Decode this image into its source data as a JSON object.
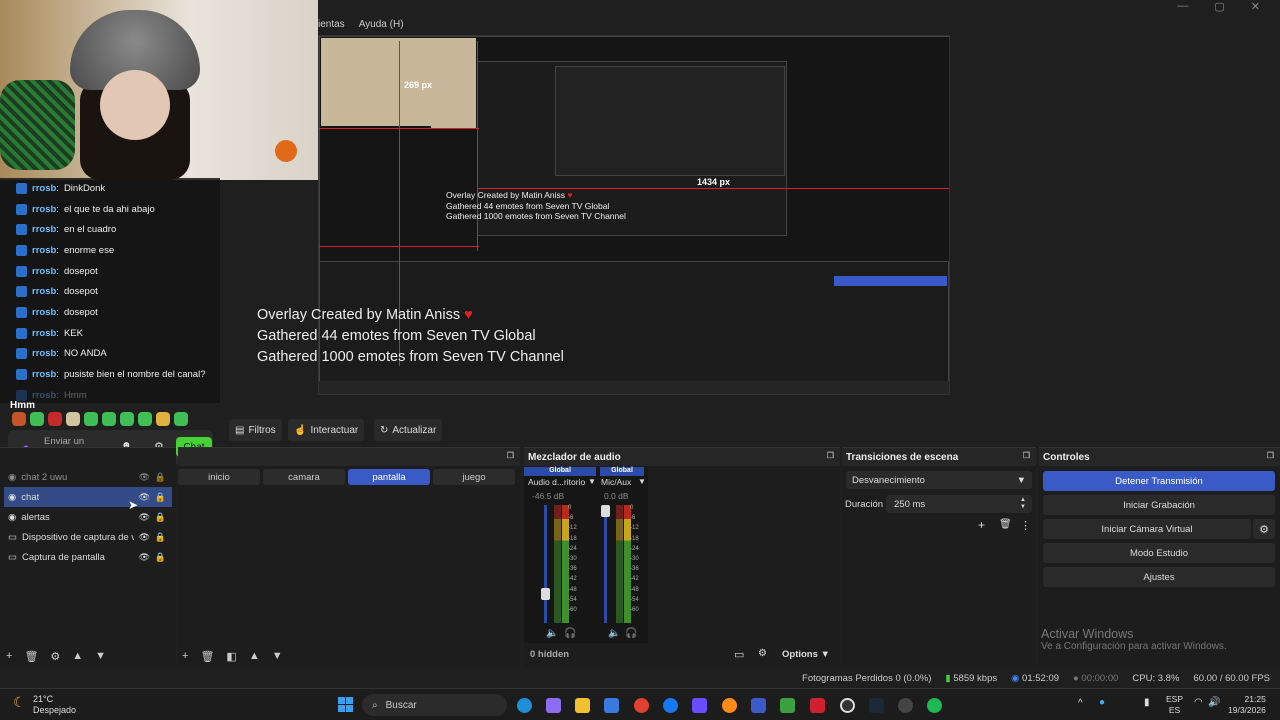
{
  "menu": {
    "items": [
      "ientas",
      "Ayuda (H)"
    ]
  },
  "window_controls": [
    "—",
    "▢",
    "✕"
  ],
  "chat": {
    "messages": [
      {
        "user": "rrosb",
        "text": "DinkDonk"
      },
      {
        "user": "rrosb",
        "text": "el que te da ahi abajo"
      },
      {
        "user": "rrosb",
        "text": "en el cuadro"
      },
      {
        "user": "rrosb",
        "text": "enorme ese"
      },
      {
        "user": "rrosb",
        "text": "dosepot"
      },
      {
        "user": "rrosb",
        "text": "dosepot"
      },
      {
        "user": "rrosb",
        "text": "dosepot"
      },
      {
        "user": "rrosb",
        "text": "KEK"
      },
      {
        "user": "rrosb",
        "text": "NO ANDA"
      },
      {
        "user": "rrosb",
        "text": "pusiste bien el nombre del canal?"
      },
      {
        "user": "rrosb",
        "text": "Hmm"
      }
    ],
    "highlight": "Hmm",
    "input_placeholder": "Enviar un mensaje",
    "chat_button": "Chat"
  },
  "overlay": {
    "line1": "Overlay Created by Matin Aniss",
    "line2": "Gathered 44 emotes from Seven TV Global",
    "line3": "Gathered 1000 emotes from Seven TV Channel",
    "measure_269": "269 px",
    "measure_1434": "1434 px"
  },
  "toolbar": {
    "filters": "Filtros",
    "interact": "Interactuar",
    "refresh": "Actualizar"
  },
  "sources": {
    "items": [
      {
        "name": "chat 2 uwu",
        "selected": false
      },
      {
        "name": "chat",
        "selected": true
      },
      {
        "name": "alertas",
        "selected": false
      },
      {
        "name": "Dispositivo de captura de vid",
        "selected": false
      },
      {
        "name": "Captura de pantalla",
        "selected": false
      }
    ]
  },
  "scenes": {
    "items": [
      {
        "name": "inicio",
        "selected": false
      },
      {
        "name": "camara",
        "selected": false
      },
      {
        "name": "pantalla",
        "selected": true
      },
      {
        "name": "juego",
        "selected": false
      }
    ]
  },
  "mixer": {
    "title": "Mezclador de audio",
    "channels": [
      {
        "header": "Global",
        "name": "Audio d...ritorio",
        "db": "-46.5 dB",
        "level": 0.22
      },
      {
        "header": "Global",
        "name": "Mic/Aux",
        "db": "0.0 dB",
        "level": 1.0
      }
    ],
    "scale": [
      "0",
      "-6",
      "-12",
      "-18",
      "-24",
      "-30",
      "-36",
      "-42",
      "-48",
      "-54",
      "-60"
    ],
    "hidden": "0 hidden",
    "options": "Options"
  },
  "transitions": {
    "title": "Transiciones de escena",
    "selected": "Desvanecimiento",
    "duration_label": "Duración",
    "duration_value": "250 ms"
  },
  "controls": {
    "title": "Controles",
    "buttons": [
      "Detener Transmisión",
      "Iniciar Grabación",
      "Iniciar Cámara Virtual",
      "Modo Estudio",
      "Ajustes"
    ]
  },
  "status": {
    "dropped": "Fotogramas Perdidos 0 (0.0%)",
    "kbps": "5859 kbps",
    "stream_time": "01:52:09",
    "rec_time": "00:00:00",
    "cpu": "CPU: 3.8%",
    "fps": "60.00 / 60.00 FPS"
  },
  "activate_windows": {
    "title": "Activar Windows",
    "subtitle": "Ve a Configuración para activar Windows."
  },
  "taskbar": {
    "weather_temp": "21°C",
    "weather_desc": "Despejado",
    "search": "Buscar",
    "lang1": "ESP",
    "lang2": "ES",
    "time": "21:25",
    "date": "19/3/2026"
  },
  "colors": {
    "accent": "#3a5bc7",
    "chat_green": "#45d233",
    "recording_red": "#d8202a"
  }
}
